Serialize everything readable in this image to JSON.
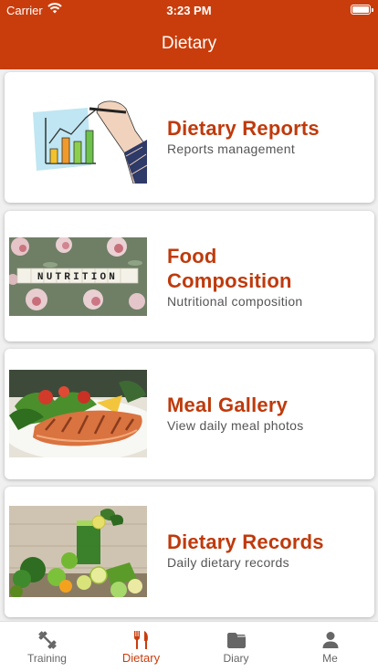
{
  "status": {
    "carrier": "Carrier",
    "time": "3:23 PM"
  },
  "header": {
    "title": "Dietary"
  },
  "cards": [
    {
      "title": "Dietary Reports",
      "subtitle": "Reports management"
    },
    {
      "title": "Food Composition",
      "subtitle": "Nutritional composition",
      "image_text": "NUTRITION"
    },
    {
      "title": "Meal Gallery",
      "subtitle": "View daily meal photos"
    },
    {
      "title": "Dietary Records",
      "subtitle": "Daily dietary records"
    }
  ],
  "tabs": [
    {
      "label": "Training",
      "icon": "dumbbell-icon"
    },
    {
      "label": "Dietary",
      "icon": "fork-knife-icon",
      "active": true
    },
    {
      "label": "Diary",
      "icon": "folder-icon"
    },
    {
      "label": "Me",
      "icon": "person-icon"
    }
  ],
  "colors": {
    "accent": "#c93d0c",
    "title": "#bf3a0c",
    "inactive_tab": "#666666"
  }
}
